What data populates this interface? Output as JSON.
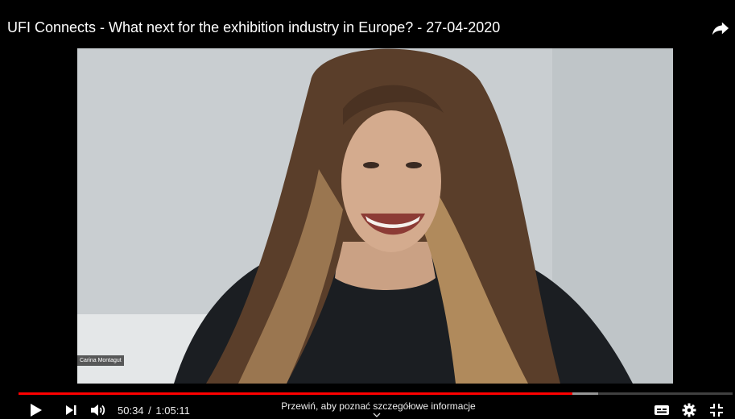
{
  "video": {
    "title": "UFI Connects - What next for the exhibition industry in Europe? - 27-04-2020",
    "speaker_name": "Carina Montagut"
  },
  "controls": {
    "current_time": "50:34",
    "separator": "/",
    "duration": "1:05:11",
    "progress_fraction": 0.776,
    "buffered_fraction": 0.812,
    "seek_hint": "Przewiń, aby poznać szczegółowe informacje"
  },
  "icons": {
    "share": "share-arrow-icon",
    "play": "play-icon",
    "next": "next-icon",
    "volume": "volume-icon",
    "captions": "captions-icon",
    "settings": "gear-icon",
    "exit_fullscreen": "exit-fullscreen-icon",
    "hint_chevron": "chevron-down-icon"
  },
  "colors": {
    "progress_played": "#ff0000",
    "background": "#000000"
  }
}
